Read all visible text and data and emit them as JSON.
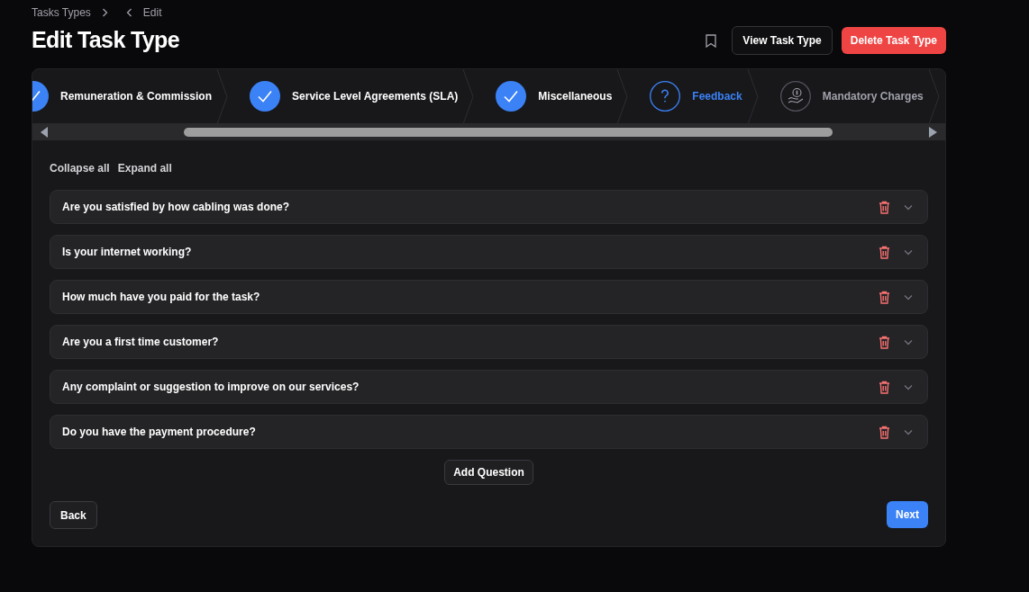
{
  "breadcrumb": [
    {
      "label": "Tasks Types"
    },
    {
      "label": "Edit"
    }
  ],
  "title": "Edit Task Type",
  "header_buttons": [
    {
      "label": "View Task Type",
      "kind": "outline"
    },
    {
      "label": "Delete Task Type",
      "kind": "danger"
    }
  ],
  "steps": [
    {
      "label": "Remuneration & Commission",
      "kind": "done"
    },
    {
      "label": "Service Level Agreements (SLA)",
      "kind": "done"
    },
    {
      "label": "Miscellaneous",
      "kind": "done"
    },
    {
      "label": "Feedback",
      "kind": "current"
    },
    {
      "label": "Mandatory Charges",
      "kind": "pending"
    }
  ],
  "toolbar": [
    {
      "label": "Collapse all"
    },
    {
      "label": "Expand all"
    }
  ],
  "questions": [
    {
      "text": "Are you satisfied by how cabling was done?",
      "expanded": false
    },
    {
      "text": "Is your internet working?",
      "expanded": false
    },
    {
      "text": "How much have you paid for the task?",
      "expanded": false
    },
    {
      "text": "Are you a first time customer?",
      "expanded": false
    },
    {
      "text": "Any complaint or suggestion to improve on our services?",
      "expanded": false
    },
    {
      "text": "Do you have the payment procedure?",
      "expanded": false
    }
  ],
  "add_button": "Add Question",
  "footer": {
    "back": "Back",
    "next": "Next"
  }
}
